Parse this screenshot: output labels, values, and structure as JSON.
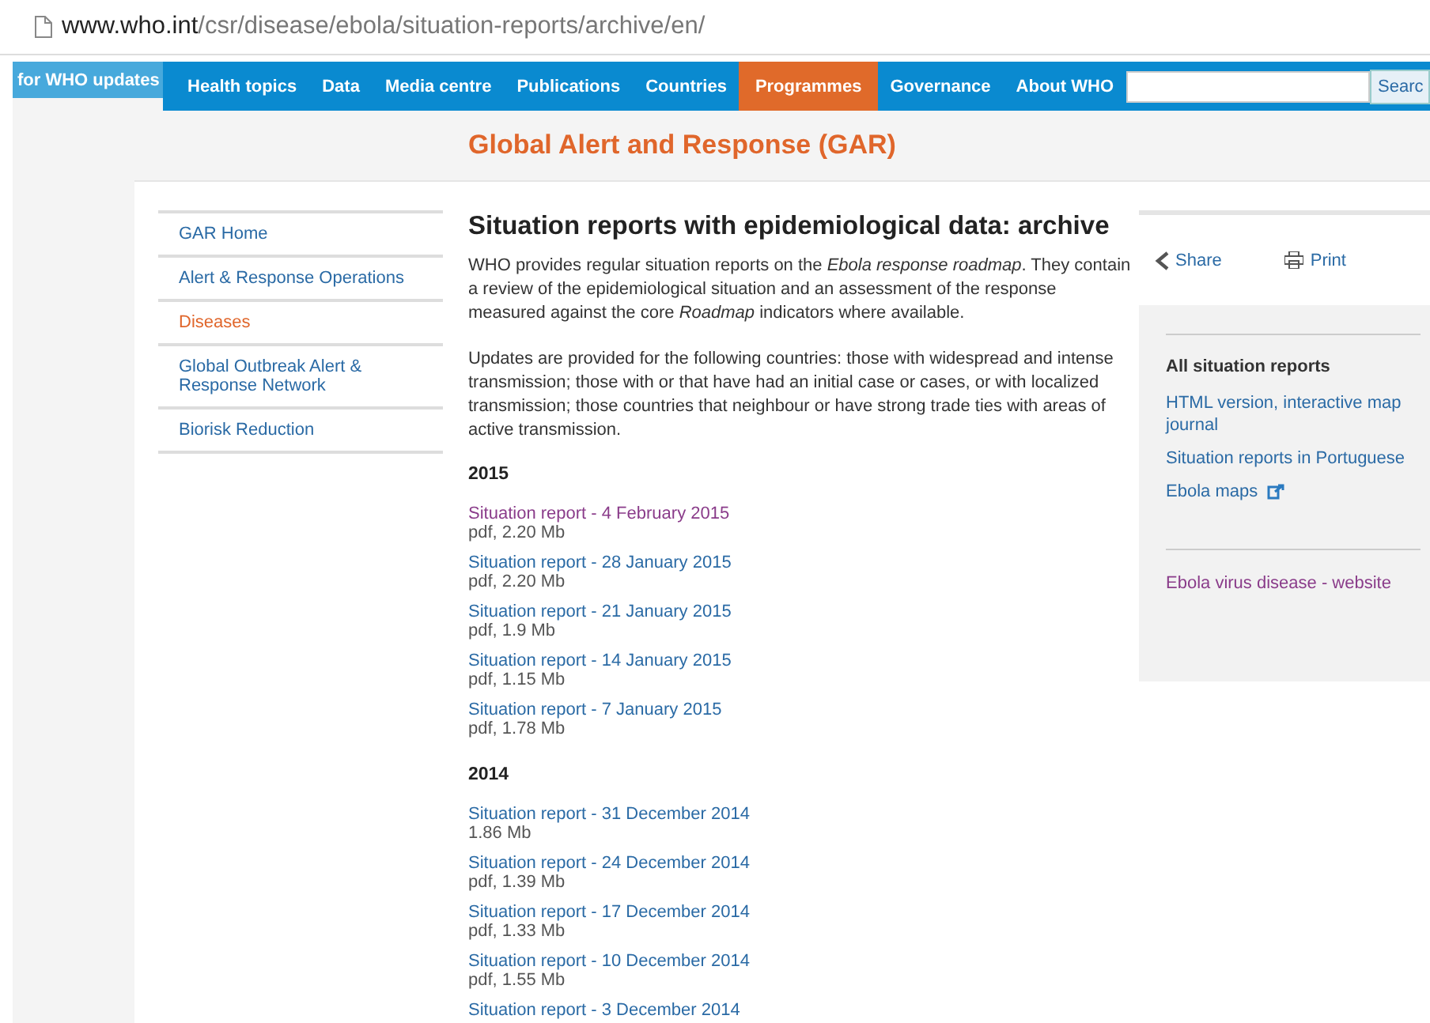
{
  "address_bar": {
    "host": "www.who.int",
    "path": "/csr/disease/ebola/situation-reports/archive/en/"
  },
  "updates_tab": {
    "label": "for WHO updates"
  },
  "nav": [
    {
      "label": "Health topics",
      "selected": false
    },
    {
      "label": "Data",
      "selected": false
    },
    {
      "label": "Media centre",
      "selected": false
    },
    {
      "label": "Publications",
      "selected": false
    },
    {
      "label": "Countries",
      "selected": false
    },
    {
      "label": "Programmes",
      "selected": true
    },
    {
      "label": "Governance",
      "selected": false
    },
    {
      "label": "About WHO",
      "selected": false
    }
  ],
  "search": {
    "button": "Searc"
  },
  "banner": {
    "title": "Global Alert and Response (GAR)"
  },
  "sidebar": {
    "items": [
      {
        "label": "GAR Home",
        "selected": false
      },
      {
        "label": "Alert & Response Operations",
        "selected": false
      },
      {
        "label": "Diseases",
        "selected": true
      },
      {
        "label": "Global Outbreak Alert & Response Network",
        "selected": false
      },
      {
        "label": "Biorisk Reduction",
        "selected": false
      }
    ]
  },
  "main": {
    "title": "Situation reports with epidemiological data: archive",
    "paragraphs": [
      "WHO provides regular situation reports on the *Ebola response roadmap*. They contain a review of the epidemiological situation and an assessment of the response measured against the core *Roadmap* indicators where available.",
      "Updates are provided for the following countries: those with widespread and intense transmission; those with or that have had an initial case or cases, or with localized transmission; those countries that neighbour or have strong trade ties with areas of active transmission."
    ],
    "sections": [
      {
        "year": "2015",
        "reports": [
          {
            "link": "Situation report - 4 February 2015",
            "visited": true,
            "size": "pdf, 2.20 Mb"
          },
          {
            "link": "Situation report - 28 January 2015",
            "visited": false,
            "size": "pdf, 2.20 Mb"
          },
          {
            "link": "Situation report - 21 January 2015",
            "visited": false,
            "size": "pdf, 1.9 Mb"
          },
          {
            "link": "Situation report - 14 January 2015",
            "visited": false,
            "size": "pdf, 1.15 Mb"
          },
          {
            "link": "Situation report - 7 January 2015",
            "visited": false,
            "size": "pdf, 1.78 Mb"
          }
        ]
      },
      {
        "year": "2014",
        "reports": [
          {
            "link": "Situation report - 31 December 2014",
            "visited": false,
            "size": "1.86 Mb"
          },
          {
            "link": "Situation report - 24 December 2014",
            "visited": false,
            "size": "pdf, 1.39 Mb"
          },
          {
            "link": "Situation report - 17 December 2014",
            "visited": false,
            "size": "pdf, 1.33 Mb"
          },
          {
            "link": "Situation report - 10 December 2014",
            "visited": false,
            "size": "pdf, 1.55 Mb"
          },
          {
            "link": "Situation report - 3 December 2014",
            "visited": false
          }
        ]
      }
    ]
  },
  "tools": {
    "share": "Share",
    "print": "Print"
  },
  "related": {
    "heading": "All situation reports",
    "links": [
      {
        "label": "HTML version, interactive map journal",
        "visited": false,
        "external": false
      },
      {
        "label": "Situation reports in Portuguese",
        "visited": false,
        "external": false
      },
      {
        "label": "Ebola maps",
        "visited": false,
        "external": true
      }
    ],
    "footer_link": {
      "label": "Ebola virus disease - website",
      "visited": true
    }
  }
}
